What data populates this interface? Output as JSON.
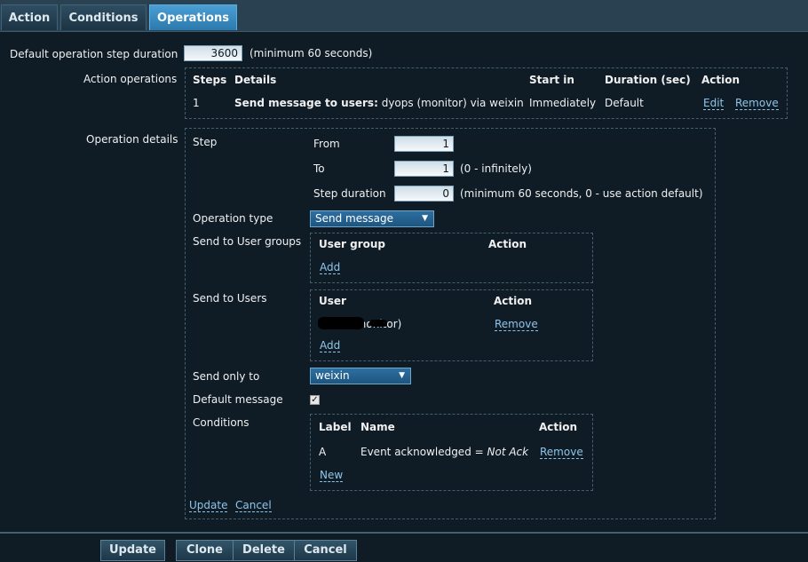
{
  "tabs": [
    {
      "label": "Action"
    },
    {
      "label": "Conditions"
    },
    {
      "label": "Operations"
    }
  ],
  "default_step_duration": {
    "label": "Default operation step duration",
    "value": "3600",
    "hint": "(minimum 60 seconds)"
  },
  "action_operations": {
    "label": "Action operations",
    "headers": {
      "steps": "Steps",
      "details": "Details",
      "start_in": "Start in",
      "duration": "Duration (sec)",
      "action": "Action"
    },
    "rows": [
      {
        "steps": "1",
        "details_bold": "Send message to users:",
        "details_rest": "dyops (monitor) via weixin",
        "start_in": "Immediately",
        "duration": "Default",
        "edit": "Edit",
        "remove": "Remove"
      }
    ]
  },
  "operation_details": {
    "label": "Operation details",
    "step": {
      "label": "Step",
      "from_label": "From",
      "from_value": "1",
      "to_label": "To",
      "to_value": "1",
      "to_hint": "(0 - infinitely)",
      "duration_label": "Step duration",
      "duration_value": "0",
      "duration_hint": "(minimum 60 seconds, 0 - use action default)"
    },
    "operation_type": {
      "label": "Operation type",
      "value": "Send message"
    },
    "user_groups": {
      "label": "Send to User groups",
      "col_group": "User group",
      "col_action": "Action",
      "add": "Add"
    },
    "users": {
      "label": "Send to Users",
      "col_user": "User",
      "col_action": "Action",
      "row_user": "(monitor)",
      "row_remove": "Remove",
      "add": "Add"
    },
    "send_only_to": {
      "label": "Send only to",
      "value": "weixin"
    },
    "default_message": {
      "label": "Default message",
      "checked": true
    },
    "conditions": {
      "label": "Conditions",
      "col_label": "Label",
      "col_name": "Name",
      "col_action": "Action",
      "row_label": "A",
      "row_name_prefix": "Event acknowledged = ",
      "row_name_value": "Not Ack",
      "row_remove": "Remove",
      "new": "New"
    },
    "update_link": "Update",
    "cancel_link": "Cancel"
  },
  "footer": {
    "update": "Update",
    "clone": "Clone",
    "delete": "Delete",
    "cancel": "Cancel"
  },
  "icons": {
    "dropdown": "caret-down-icon",
    "checkmark": "check-icon"
  }
}
